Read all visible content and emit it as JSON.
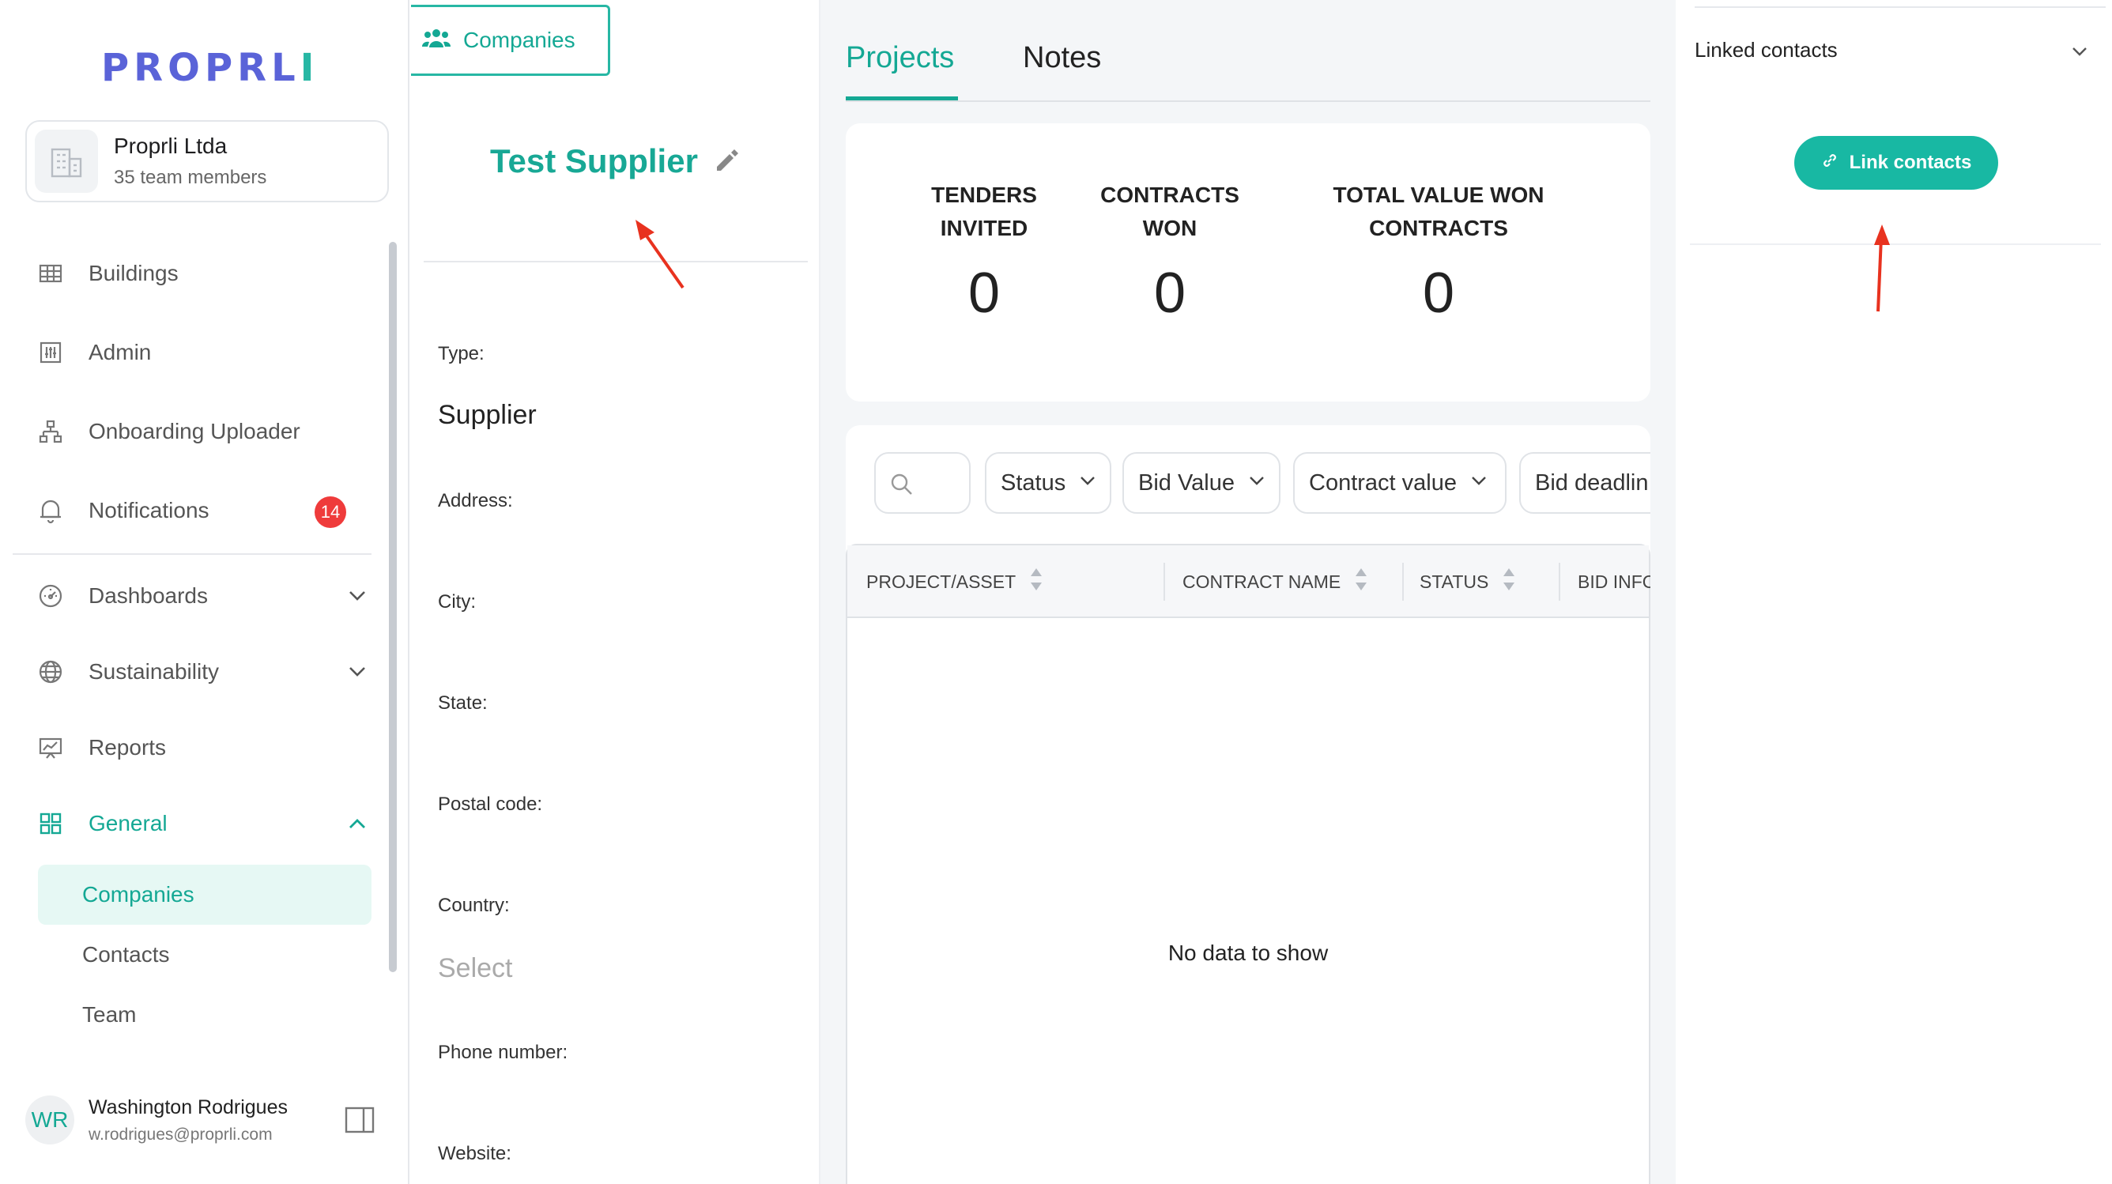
{
  "brand": {
    "logo_main": "PROPRL",
    "logo_tail": "I",
    "accent": "#14a894",
    "accent_button": "#18b8a3",
    "badge_color": "#ef3b3b"
  },
  "organization": {
    "name": "Proprli Ltda",
    "members": "35 team members"
  },
  "sidebar": {
    "items": [
      {
        "label": "Buildings",
        "icon": "buildings-icon"
      },
      {
        "label": "Admin",
        "icon": "admin-icon"
      },
      {
        "label": "Onboarding Uploader",
        "icon": "org-chart-icon"
      },
      {
        "label": "Notifications",
        "icon": "bell-icon",
        "badge": "14"
      },
      {
        "label": "Dashboards",
        "icon": "gauge-icon"
      },
      {
        "label": "Sustainability",
        "icon": "globe-icon"
      },
      {
        "label": "Reports",
        "icon": "presentation-chart-icon"
      },
      {
        "label": "General",
        "icon": "grid-icon"
      }
    ],
    "general_children": [
      "Companies",
      "Contacts",
      "Team"
    ]
  },
  "user": {
    "initials": "WR",
    "name": "Washington Rodrigues",
    "email": "w.rodrigues@proprli.com"
  },
  "details": {
    "tab_label": "Companies",
    "company_name": "Test Supplier",
    "fields": {
      "type_label": "Type:",
      "type_value": "Supplier",
      "address_label": "Address:",
      "city_label": "City:",
      "state_label": "State:",
      "postal_label": "Postal code:",
      "country_label": "Country:",
      "country_placeholder": "Select",
      "phone_label": "Phone number:",
      "website_label": "Website:"
    }
  },
  "projects": {
    "tabs": [
      "Projects",
      "Notes"
    ],
    "stats": [
      {
        "line1": "TENDERS",
        "line2": "INVITED",
        "value": "0"
      },
      {
        "line1": "CONTRACTS",
        "line2": "WON",
        "value": "0"
      },
      {
        "line1": "TOTAL VALUE WON",
        "line2": "CONTRACTS",
        "value": "0"
      }
    ],
    "filters": [
      "Status",
      "Bid Value",
      "Contract value",
      "Bid deadlin"
    ],
    "columns": [
      "PROJECT/ASSET",
      "CONTRACT NAME",
      "STATUS",
      "BID INFO"
    ],
    "empty": "No data to show"
  },
  "linked_contacts": {
    "title": "Linked contacts",
    "button": "Link contacts"
  }
}
